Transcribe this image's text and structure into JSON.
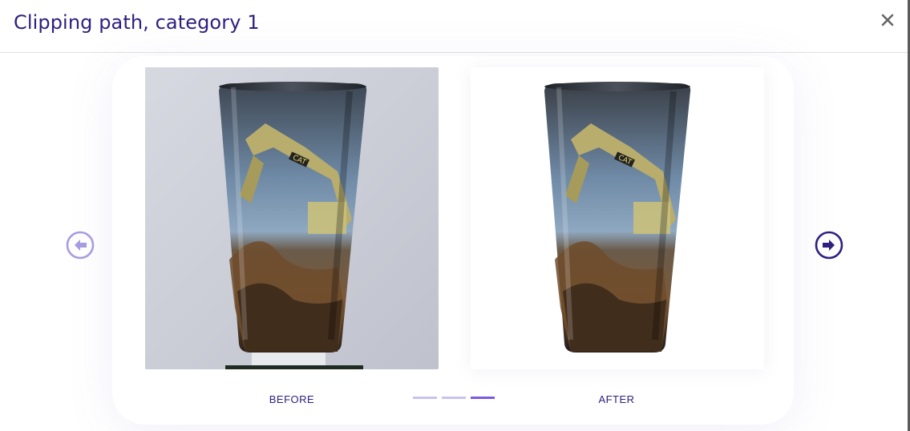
{
  "modal": {
    "title": "Clipping path, category 1",
    "close_icon": "close-icon"
  },
  "slider": {
    "before_label": "BEFORE",
    "after_label": "AFTER",
    "slide_count": 3,
    "active_slide": 3,
    "prev_icon": "arrow-left-circle-icon",
    "next_icon": "arrow-right-circle-icon"
  },
  "colors": {
    "primary": "#2d2080",
    "accent": "#7a5be0",
    "prev_disabled": "#a99be0",
    "dot_inactive": "#c9c3ee",
    "before_background": "#c9ccd6"
  }
}
